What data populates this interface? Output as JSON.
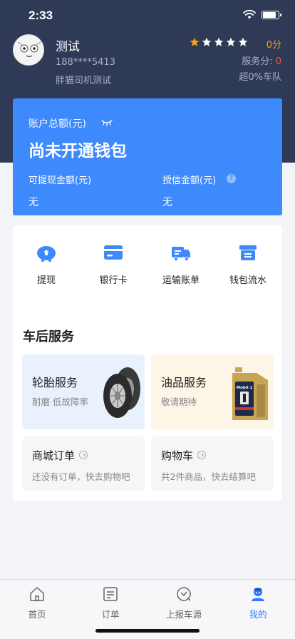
{
  "status_bar": {
    "time": "2:33",
    "battery_level": 0.85
  },
  "profile": {
    "name": "测试",
    "phone": "188****5413",
    "team": "胖猫司机测试",
    "rating_stars": 5,
    "rating_score": "0分",
    "service_score_label": "服务分: ",
    "service_score_value": "0",
    "team_rank": "超0%车队"
  },
  "wallet": {
    "total_label": "账户总额(元)",
    "status": "尚未开通钱包",
    "withdrawable_label": "可提现金额(元)",
    "withdrawable_value": "无",
    "credit_label": "授信金额(元)",
    "credit_help": "?",
    "credit_value": "无"
  },
  "quick_actions": [
    {
      "label": "提现",
      "icon": "piggy-bank-icon"
    },
    {
      "label": "银行卡",
      "icon": "bank-card-icon"
    },
    {
      "label": "运输账单",
      "icon": "truck-icon"
    },
    {
      "label": "钱包流水",
      "icon": "ledger-box-icon"
    }
  ],
  "after_sales": {
    "title": "车后服务",
    "tire": {
      "title": "轮胎服务",
      "sub": "耐磨 低故障率"
    },
    "oil": {
      "title": "油品服务",
      "sub": "敬请期待",
      "brand": "Mobil 1"
    },
    "mall_orders": {
      "title": "商城订单",
      "sub": "还没有订单，快去购物吧"
    },
    "cart": {
      "title": "购物车",
      "sub": "共2件商品，快去结算吧"
    }
  },
  "tabbar": {
    "items": [
      {
        "label": "首页",
        "icon": "home-icon"
      },
      {
        "label": "订单",
        "icon": "order-list-icon"
      },
      {
        "label": "上报车源",
        "icon": "report-source-icon"
      },
      {
        "label": "我的",
        "icon": "profile-icon"
      }
    ],
    "active_index": 3
  },
  "colors": {
    "header_bg": "#2e3a56",
    "accent_blue": "#3e89fb",
    "star_gold": "#f7a21b",
    "alert_red": "#ff4d4f",
    "active_tab": "#2f7cf6"
  }
}
